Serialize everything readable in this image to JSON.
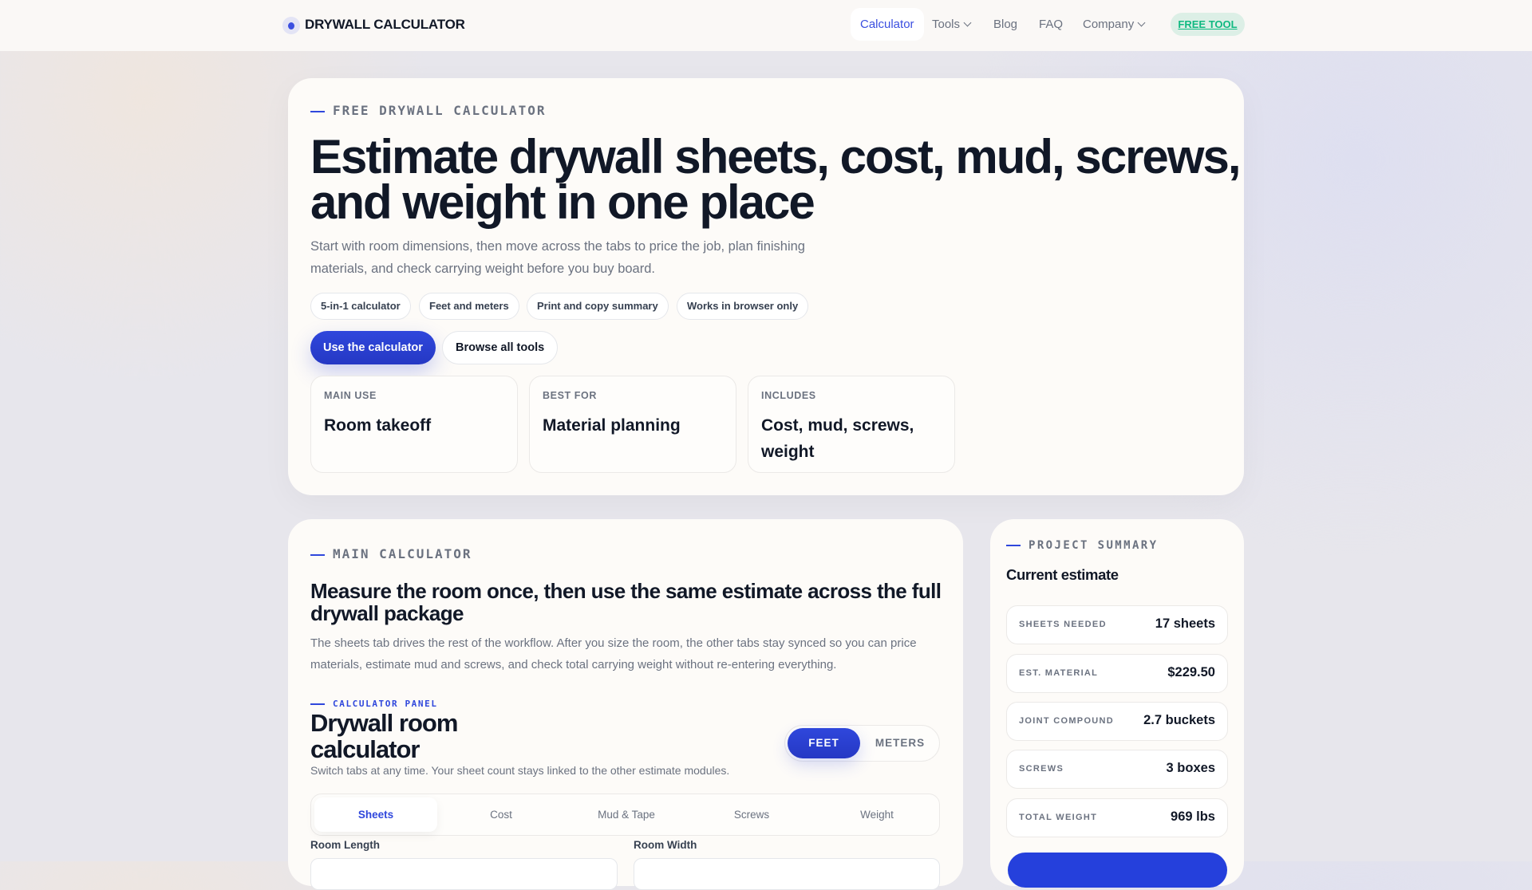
{
  "header": {
    "logo": "DRYWALL CALCULATOR",
    "nav": [
      {
        "label": "Calculator"
      },
      {
        "label": "Tools"
      },
      {
        "label": "Blog"
      },
      {
        "label": "FAQ"
      },
      {
        "label": "Company"
      }
    ],
    "badge": "FREE TOOL"
  },
  "hero": {
    "eyebrow": "FREE DRYWALL CALCULATOR",
    "title_line1": "Estimate drywall sheets, cost, mud, screws,",
    "title_line2": "and weight in one place",
    "lead_line1": "Start with room dimensions, then move across the tabs to price the job, plan finishing",
    "lead_line2": "materials, and check carrying weight before you buy board.",
    "chips": [
      "5-in-1 calculator",
      "Feet and meters",
      "Print and copy summary",
      "Works in browser only"
    ],
    "primary_button": "Use the calculator",
    "secondary_button": "Browse all tools",
    "info": [
      {
        "label": "MAIN USE",
        "value": "Room takeoff"
      },
      {
        "label": "BEST FOR",
        "value": "Material planning"
      },
      {
        "label": "INCLUDES",
        "value": "Cost, mud, screws, weight"
      }
    ]
  },
  "main": {
    "eyebrow": "MAIN CALCULATOR",
    "title": "Measure the room once, then use the same estimate across the full drywall package",
    "desc_line1": "The sheets tab drives the rest of the workflow. After you size the room, the other tabs stay synced so you can price",
    "desc_line2": "materials, estimate mud and screws, and check total carrying weight without re-entering everything.",
    "panel_eyebrow": "CALCULATOR PANEL",
    "panel_title_line1": "Drywall room",
    "panel_title_line2": "calculator",
    "panel_sub": "Switch tabs at any time. Your sheet count stays linked to the other estimate modules.",
    "units": [
      "FEET",
      "METERS"
    ],
    "tabs": [
      "Sheets",
      "Cost",
      "Mud & Tape",
      "Screws",
      "Weight"
    ],
    "fields": [
      "Room Length",
      "Room Width"
    ]
  },
  "summary": {
    "eyebrow": "PROJECT SUMMARY",
    "title": "Current estimate",
    "rows": [
      {
        "label": "SHEETS NEEDED",
        "value": "17 sheets"
      },
      {
        "label": "EST. MATERIAL",
        "value": "$229.50"
      },
      {
        "label": "JOINT COMPOUND",
        "value": "2.7 buckets"
      },
      {
        "label": "SCREWS",
        "value": "3 boxes"
      },
      {
        "label": "TOTAL WEIGHT",
        "value": "969 lbs"
      }
    ]
  }
}
